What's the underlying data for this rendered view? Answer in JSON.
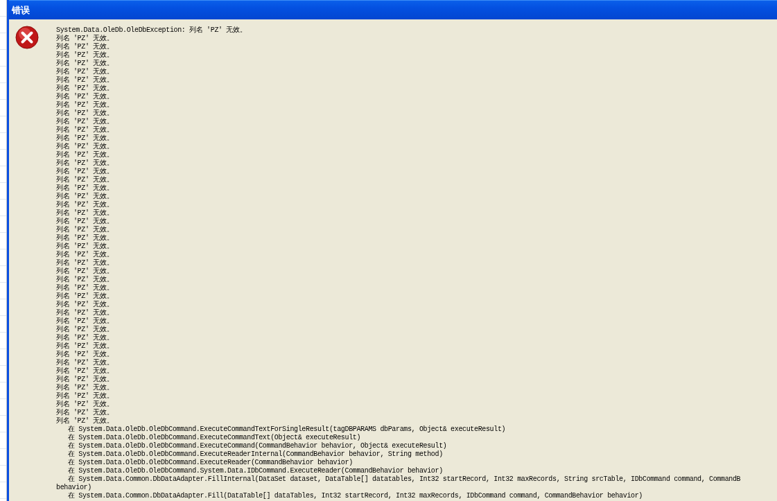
{
  "window": {
    "title": "错误"
  },
  "message": {
    "lines": [
      "System.Data.OleDb.OleDbException: 列名 'PZ' 无效。",
      "列名 'PZ' 无效。",
      "列名 'PZ' 无效。",
      "列名 'PZ' 无效。",
      "列名 'PZ' 无效。",
      "列名 'PZ' 无效。",
      "列名 'PZ' 无效。",
      "列名 'PZ' 无效。",
      "列名 'PZ' 无效。",
      "列名 'PZ' 无效。",
      "列名 'PZ' 无效。",
      "列名 'PZ' 无效。",
      "列名 'PZ' 无效。",
      "列名 'PZ' 无效。",
      "列名 'PZ' 无效。",
      "列名 'PZ' 无效。",
      "列名 'PZ' 无效。",
      "列名 'PZ' 无效。",
      "列名 'PZ' 无效。",
      "列名 'PZ' 无效。",
      "列名 'PZ' 无效。",
      "列名 'PZ' 无效。",
      "列名 'PZ' 无效。",
      "列名 'PZ' 无效。",
      "列名 'PZ' 无效。",
      "列名 'PZ' 无效。",
      "列名 'PZ' 无效。",
      "列名 'PZ' 无效。",
      "列名 'PZ' 无效。",
      "列名 'PZ' 无效。",
      "列名 'PZ' 无效。",
      "列名 'PZ' 无效。",
      "列名 'PZ' 无效。",
      "列名 'PZ' 无效。",
      "列名 'PZ' 无效。",
      "列名 'PZ' 无效。",
      "列名 'PZ' 无效。",
      "列名 'PZ' 无效。",
      "列名 'PZ' 无效。",
      "列名 'PZ' 无效。",
      "列名 'PZ' 无效。",
      "列名 'PZ' 无效。",
      "列名 'PZ' 无效。",
      "列名 'PZ' 无效。",
      "列名 'PZ' 无效。",
      "列名 'PZ' 无效。",
      "列名 'PZ' 无效。",
      "列名 'PZ' 无效。",
      "   在 System.Data.OleDb.OleDbCommand.ExecuteCommandTextForSingleResult(tagDBPARAMS dbParams, Object& executeResult)",
      "   在 System.Data.OleDb.OleDbCommand.ExecuteCommandText(Object& executeResult)",
      "   在 System.Data.OleDb.OleDbCommand.ExecuteCommand(CommandBehavior behavior, Object& executeResult)",
      "   在 System.Data.OleDb.OleDbCommand.ExecuteReaderInternal(CommandBehavior behavior, String method)",
      "   在 System.Data.OleDb.OleDbCommand.ExecuteReader(CommandBehavior behavior)",
      "   在 System.Data.OleDb.OleDbCommand.System.Data.IDbCommand.ExecuteReader(CommandBehavior behavior)",
      "   在 System.Data.Common.DbDataAdapter.FillInternal(DataSet dataset, DataTable[] datatables, Int32 startRecord, Int32 maxRecords, String srcTable, IDbCommand command, CommandB",
      "behavior)",
      "   在 System.Data.Common.DbDataAdapter.Fill(DataTable[] dataTables, Int32 startRecord, Int32 maxRecords, IDbCommand command, CommandBehavior behavior)"
    ]
  }
}
